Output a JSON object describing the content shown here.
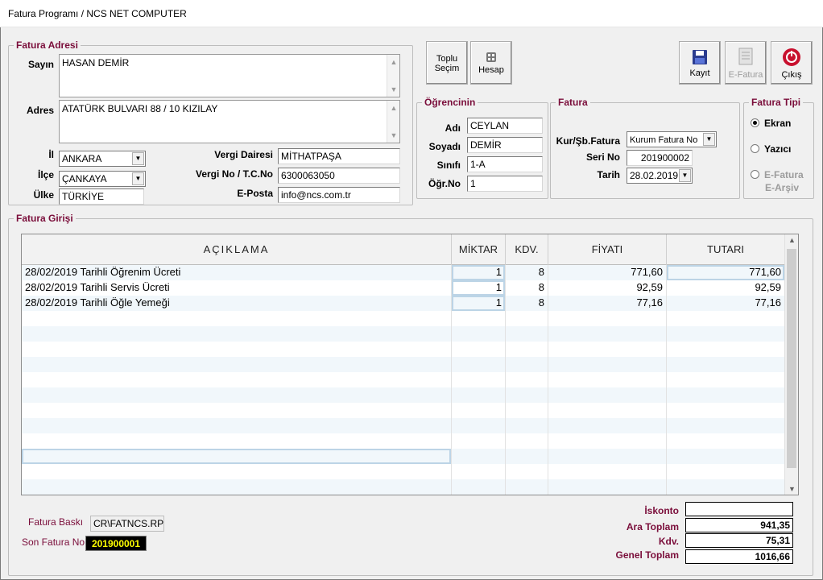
{
  "window": {
    "title": "Fatura Programı / NCS NET COMPUTER"
  },
  "address": {
    "legend": "Fatura Adresi",
    "sayin_label": "Sayın",
    "sayin_value": "HASAN DEMİR",
    "adres_label": "Adres",
    "adres_value": "ATATÜRK BULVARI 88 / 10 KIZILAY",
    "il_label": "İl",
    "il_value": "ANKARA",
    "ilce_label": "İlçe",
    "ilce_value": "ÇANKAYA",
    "ulke_label": "Ülke",
    "ulke_value": "TÜRKİYE",
    "vergi_dairesi_label": "Vergi Dairesi",
    "vergi_dairesi_value": "MİTHATPAŞA",
    "vergi_no_label": "Vergi No / T.C.No",
    "vergi_no_value": "6300063050",
    "eposta_label": "E-Posta",
    "eposta_value": "info@ncs.com.tr"
  },
  "toolbar": {
    "toplu_label_1": "Toplu",
    "toplu_label_2": "Seçim",
    "hesap_label": "Hesap",
    "kayit_label": "Kayıt",
    "efatura_label": "E-Fatura",
    "cikis_label": "Çıkış"
  },
  "student": {
    "legend": "Öğrencinin",
    "adi_label": "Adı",
    "adi_value": "CEYLAN",
    "soyadi_label": "Soyadı",
    "soyadi_value": "DEMİR",
    "sinifi_label": "Sınıfı",
    "sinifi_value": "1-A",
    "ogrno_label": "Öğr.No",
    "ogrno_value": "1"
  },
  "invoice": {
    "legend": "Fatura",
    "kur_label": "Kur/Şb.Fatura",
    "kur_value": "Kurum  Fatura No",
    "seri_label": "Seri No",
    "seri_value": "201900002",
    "tarih_label": "Tarih",
    "tarih_value": "28.02.2019"
  },
  "invoice_type": {
    "legend": "Fatura Tipi",
    "ekran": "Ekran",
    "yazici": "Yazıcı",
    "efatura_1": "E-Fatura",
    "efatura_2": "E-Arşiv"
  },
  "entry": {
    "legend": "Fatura Girişi",
    "columns": [
      "AÇIKLAMA",
      "MİKTAR",
      "KDV.",
      "FİYATI",
      "TUTARI"
    ],
    "rows": [
      {
        "aciklama": "28/02/2019 Tarihli Öğrenim Ücreti",
        "miktar": "1",
        "kdv": "8",
        "fiyati": "771,60",
        "tutari": "771,60"
      },
      {
        "aciklama": "28/02/2019 Tarihli Servis Ücreti",
        "miktar": "1",
        "kdv": "8",
        "fiyati": "92,59",
        "tutari": "92,59"
      },
      {
        "aciklama": "28/02/2019 Tarihli Öğle Yemeği",
        "miktar": "1",
        "kdv": "8",
        "fiyati": "77,16",
        "tutari": "77,16"
      }
    ]
  },
  "footer": {
    "baski_label": "Fatura Baskı",
    "baski_value": "CR\\FATNCS.RPT",
    "son_label": "Son Fatura No",
    "son_value": "201900001"
  },
  "totals": {
    "iskonto_label": "İskonto",
    "iskonto_value": "",
    "ara_label": "Ara Toplam",
    "ara_value": "941,35",
    "kdv_label": "Kdv.",
    "kdv_value": "75,31",
    "genel_label": "Genel Toplam",
    "genel_value": "1016,66"
  },
  "colors": {
    "legend": "#7a0d3a",
    "row_alt": "#f1f7fb",
    "son_fatura_bg": "#000000",
    "son_fatura_fg": "#ffff00"
  }
}
